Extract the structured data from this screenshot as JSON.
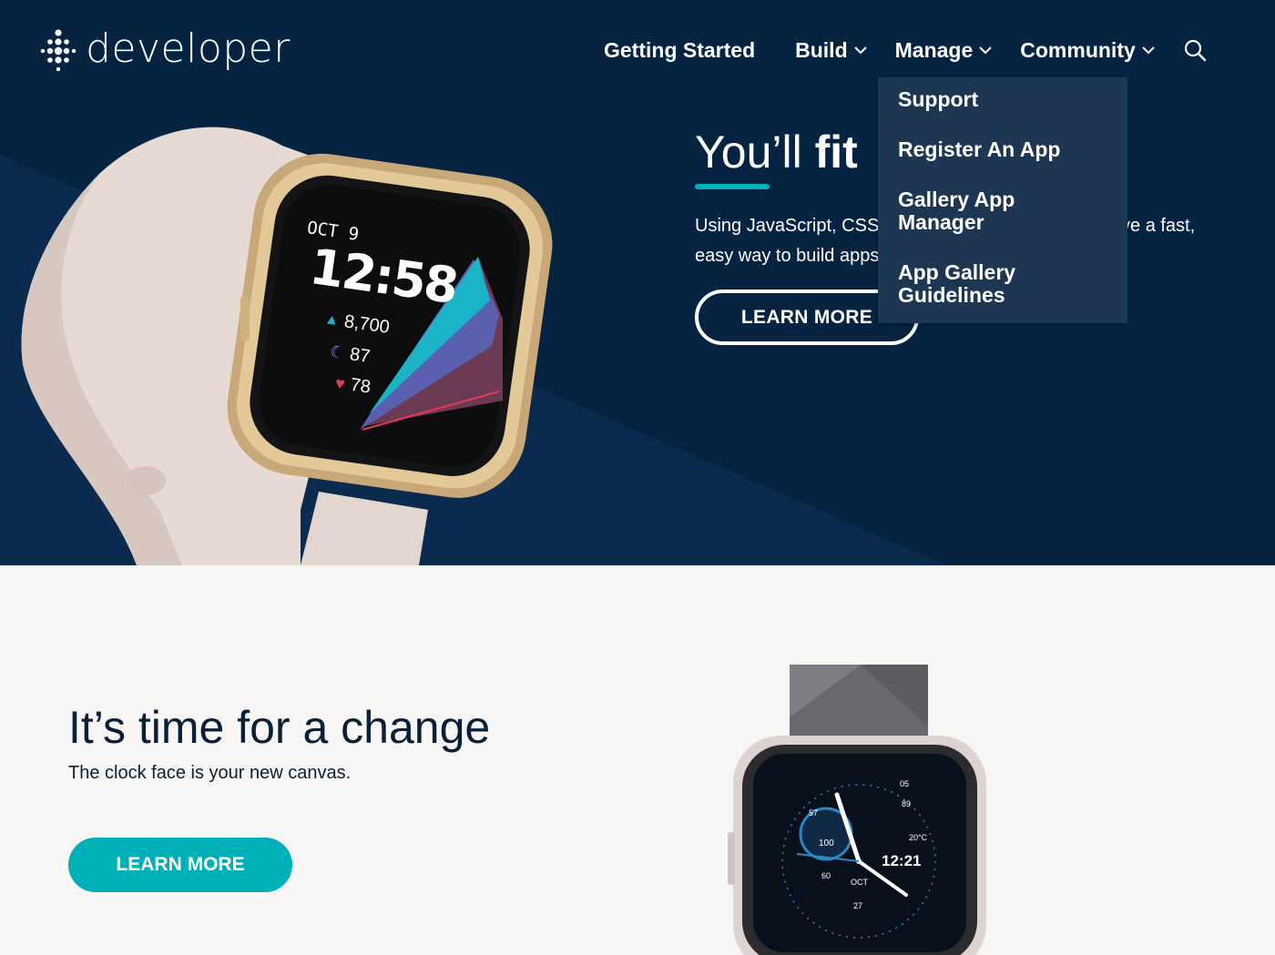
{
  "brand": {
    "name": "developer"
  },
  "nav": {
    "getting_started": "Getting Started",
    "build": "Build",
    "manage": "Manage",
    "community": "Community"
  },
  "manage_menu": {
    "items": [
      "Support",
      "Register An App",
      "Gallery App Manager",
      "App Gallery Guidelines"
    ]
  },
  "hero": {
    "title_light": "You’ll ",
    "title_bold": "fit",
    "body": "Using JavaScript, CSS and SVG, developers now have a fast, easy way to build apps and clock faces for Fitbit OS.",
    "button": "LEARN MORE"
  },
  "hero_watch": {
    "date": "OCT 9",
    "time": "12:58",
    "steps": "8,700",
    "sleep": "87",
    "heart": "78"
  },
  "promo": {
    "title": "It’s time for a change",
    "subtitle": "The clock face is your new canvas.",
    "button": "LEARN MORE"
  },
  "promo_watch": {
    "time": "12:21",
    "goal": "57",
    "battery": "100",
    "heart_rate": "60",
    "date_month": "OCT",
    "date_day": "27",
    "avg": "89",
    "temp": "20°C",
    "top_num": "05"
  },
  "colors": {
    "hero_bg": "#062442",
    "accent": "#00b0b9",
    "dropdown_bg": "#1d3652",
    "page_bg": "#f7f6f4"
  }
}
